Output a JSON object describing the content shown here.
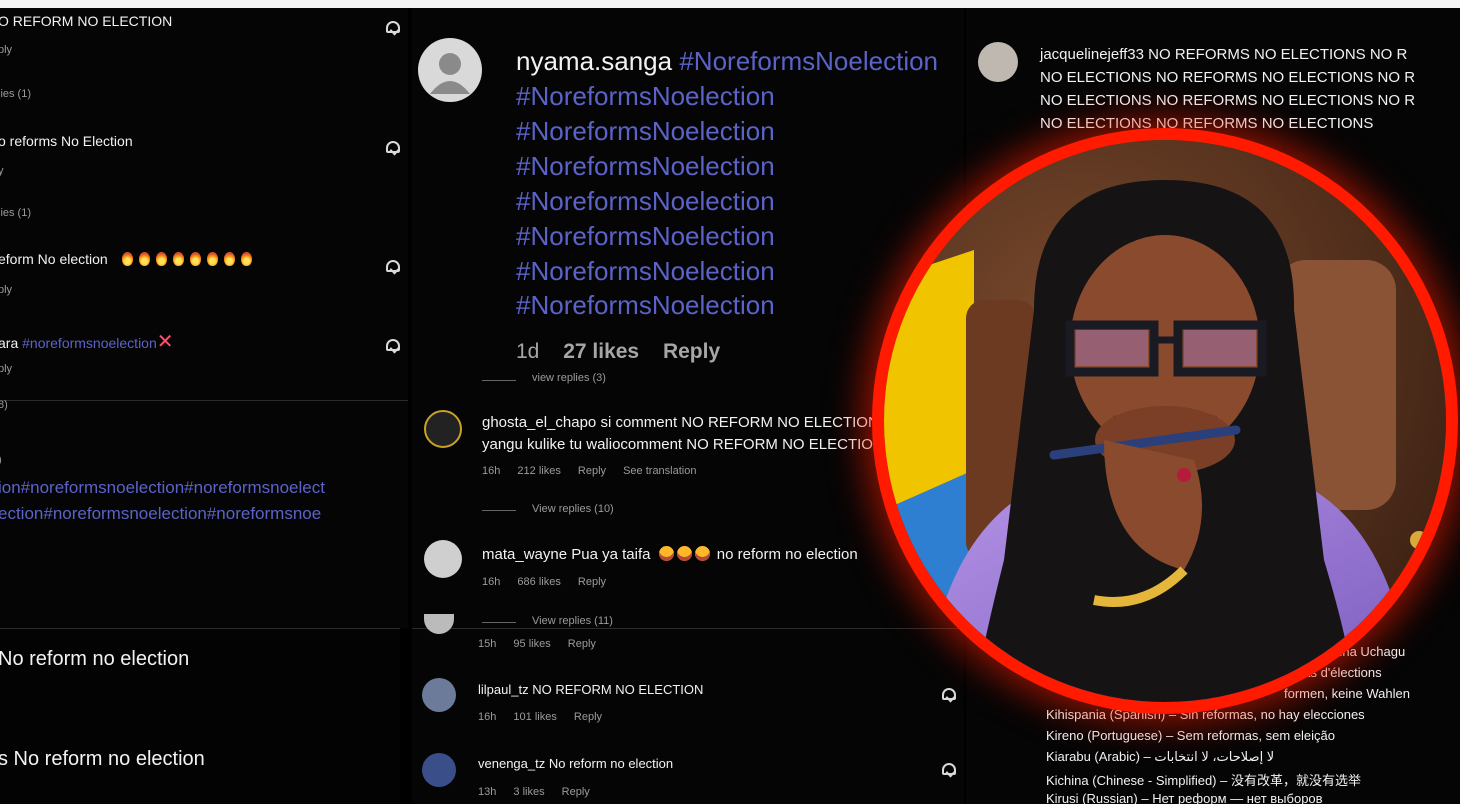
{
  "left_panel": {
    "comments": [
      {
        "text": "O REFORM NO ELECTION",
        "reply": "ply",
        "replies": "lies (1)"
      },
      {
        "text": "o reforms No Election",
        "reply": "y",
        "replies": "lies (1)"
      },
      {
        "text": "eform No election",
        "reply": "ply",
        "replies": ""
      },
      {
        "prefix": "ara ",
        "tag": "#noreformsnoelection",
        "reply": "ply",
        "replies": "8)"
      }
    ],
    "tag_lines": [
      "ion#noreformsnoelection#noreformsnoelect",
      "ection#noreformsnoelection#noreformsnoe"
    ],
    "bottom_lines": [
      "No reform no election",
      "s No reform no election"
    ]
  },
  "middle_panel": {
    "username": "nyama.sanga",
    "hashtag": "#NoreformsNoelection",
    "hashtag_lines": 7,
    "meta": {
      "age": "1d",
      "likes": "27 likes",
      "reply": "Reply"
    },
    "view_replies_top": "view replies (3)",
    "comments": [
      {
        "user": "ghosta_el_chapo",
        "text": "si comment NO REFORM NO ELECTION",
        "text2": "yangu kulike tu waliocomment NO REFORM NO ELECTIO",
        "meta": [
          "16h",
          "212 likes",
          "Reply",
          "See translation"
        ],
        "view": "View replies (10)"
      },
      {
        "user": "mata_wayne",
        "text": "Pua ya taifa",
        "suffix": "no reform no election",
        "meta": [
          "16h",
          "686 likes",
          "Reply"
        ],
        "view": "View replies (11)"
      },
      {
        "user": "",
        "text": "",
        "meta": [
          "15h",
          "95 likes",
          "Reply"
        ]
      },
      {
        "user": "lilpaul_tz",
        "text": "NO REFORM NO ELECTION",
        "meta": [
          "16h",
          "101 likes",
          "Reply"
        ]
      },
      {
        "user": "venenga_tz",
        "text": "No reform no election",
        "meta": [
          "13h",
          "3 likes",
          "Reply"
        ]
      }
    ]
  },
  "right_panel": {
    "username": "jacquelinejeff33",
    "lines": [
      "NO REFORMS NO ELECTIONS NO R",
      "NO ELECTIONS NO REFORMS NO ELECTIONS NO R",
      "NO ELECTIONS NO REFORMS NO ELECTIONS NO R",
      "NO ELECTIONS NO REFORMS NO ELECTIONS"
    ],
    "translations": [
      "Hakuna Uchagu",
      "pas d'élections",
      "formen, keine Wahlen",
      "Kihispania (Spanish) – Sin reformas, no hay elecciones",
      "Kireno (Portuguese) – Sem reformas, sem eleição",
      "Kiarabu (Arabic) – لا إصلاحات، لا انتخابات",
      "Kichina (Chinese - Simplified) – 没有改革，就没有选举",
      "Kirusi (Russian) – Нет реформ — нет выборов"
    ]
  },
  "colors": {
    "hashtag": "#5b63c9",
    "ring": "#ff1a00",
    "background": "#050505"
  }
}
